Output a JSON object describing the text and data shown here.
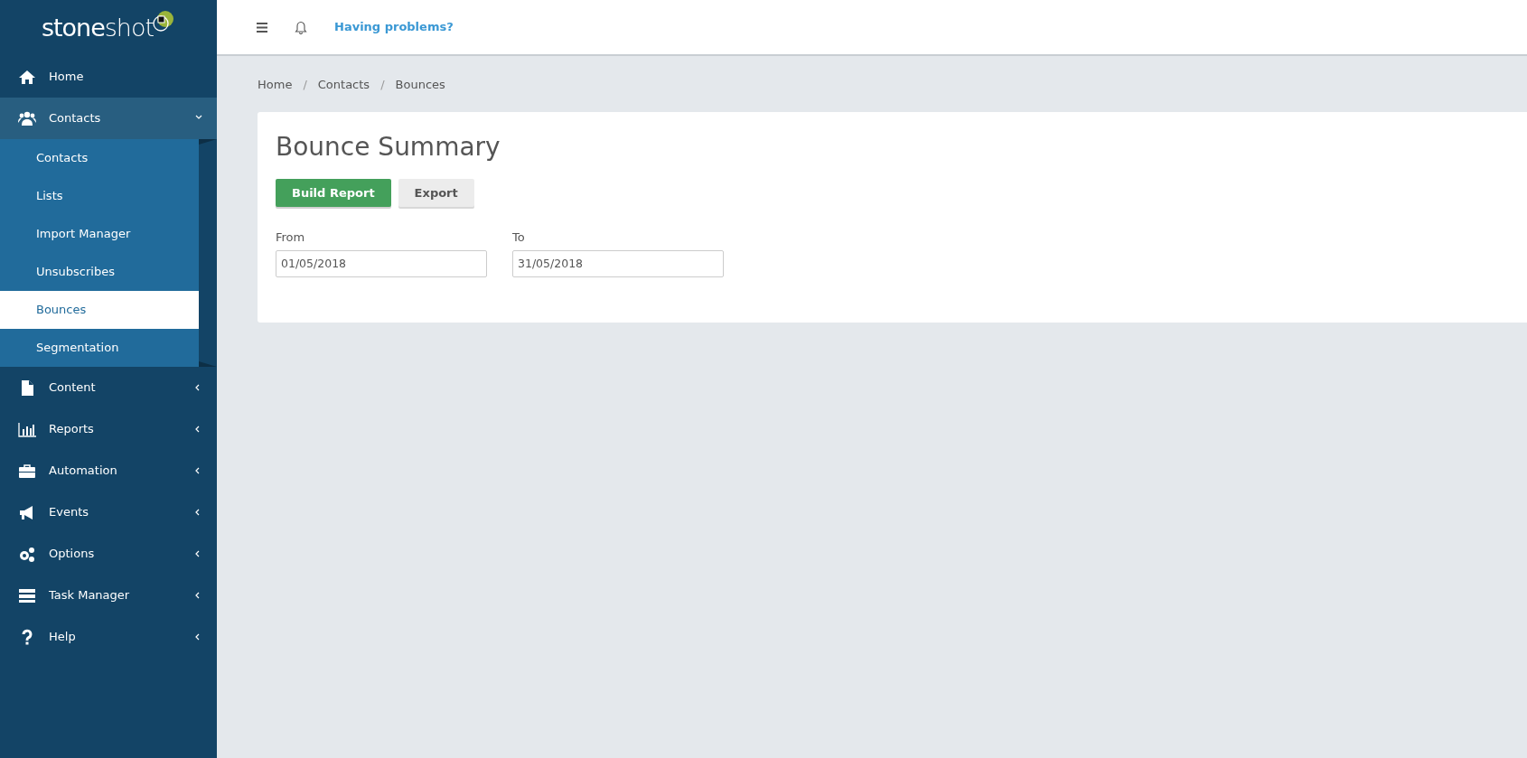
{
  "logo": {
    "text": "**stone**shot"
  },
  "sidebar": {
    "items": [
      {
        "label": "Home",
        "kind": "link"
      },
      {
        "label": "Contacts",
        "kind": "group",
        "expanded": true,
        "children": [
          {
            "label": "Contacts",
            "selected": false
          },
          {
            "label": "Lists",
            "selected": false
          },
          {
            "label": "Import Manager",
            "selected": false
          },
          {
            "label": "Unsubscribes",
            "selected": false
          },
          {
            "label": "Bounces",
            "selected": true
          },
          {
            "label": "Segmentation",
            "selected": false
          }
        ]
      },
      {
        "label": "Content",
        "kind": "group",
        "expanded": false
      },
      {
        "label": "Reports",
        "kind": "group",
        "expanded": false
      },
      {
        "label": "Automation",
        "kind": "group",
        "expanded": false
      },
      {
        "label": "Events",
        "kind": "group",
        "expanded": false
      },
      {
        "label": "Options",
        "kind": "group",
        "expanded": false
      },
      {
        "label": "Task Manager",
        "kind": "group",
        "expanded": false
      },
      {
        "label": "Help",
        "kind": "group",
        "expanded": false
      }
    ]
  },
  "topbar": {
    "help_link": "Having problems?"
  },
  "breadcrumb": [
    {
      "label": "Home",
      "kind": "link"
    },
    {
      "label": "/",
      "kind": "separator"
    },
    {
      "label": "Contacts",
      "kind": "link"
    },
    {
      "label": "/",
      "kind": "separator"
    },
    {
      "label": "Bounces",
      "kind": "current"
    }
  ],
  "panel": {
    "title": "Bounce Summary",
    "buttons": [
      {
        "label": "Build Report",
        "kind": "primary"
      },
      {
        "label": "Export",
        "kind": "secondary"
      }
    ],
    "fields": [
      {
        "label": "From",
        "value": "01/05/2018"
      },
      {
        "label": "To",
        "value": "31/05/2018"
      }
    ]
  }
}
